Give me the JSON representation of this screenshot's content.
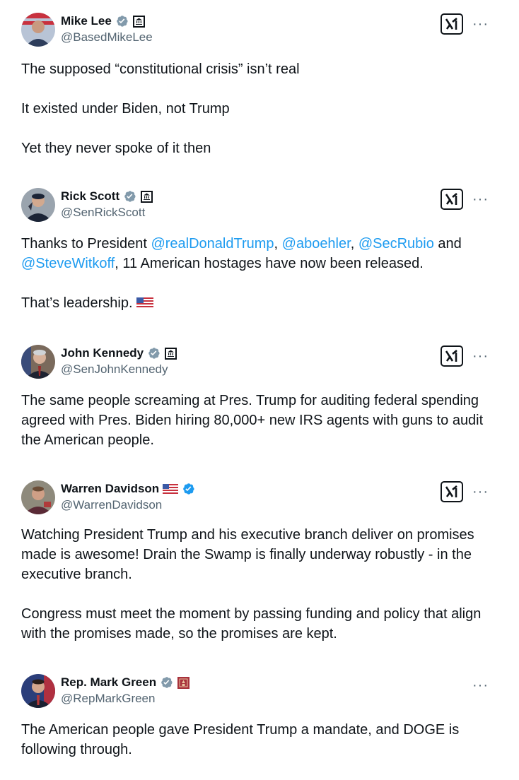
{
  "tweets": [
    {
      "name": "Mike Lee",
      "handle": "@BasedMikeLee",
      "badge": "government-icon",
      "paragraphs": [
        "The supposed “constitutional crisis” isn’t real",
        "It existed under Biden, not Trump",
        "Yet they never spoke of it then"
      ],
      "has_grok": true
    },
    {
      "name": "Rick Scott",
      "handle": "@SenRickScott",
      "badge": "government-icon",
      "p1_prefix": "Thanks to President ",
      "mention_1": "@realDonaldTrump",
      "sep_1": ", ",
      "mention_2": "@aboehler",
      "sep_2": ", ",
      "mention_3": "@SecRubio",
      "sep_3": " and ",
      "mention_4": "@SteveWitkoff",
      "p1_suffix": ", 11 American hostages have now been released.",
      "p2": "That’s leadership.",
      "flag": "us-flag-icon",
      "has_grok": true
    },
    {
      "name": "John Kennedy",
      "handle": "@SenJohnKennedy",
      "badge": "government-icon",
      "paragraphs": [
        "The same people screaming at Pres. Trump for auditing federal spending agreed with Pres. Biden hiring 80,000+ new IRS agents with guns to audit the American people."
      ],
      "has_grok": true
    },
    {
      "name": "Warren Davidson",
      "handle": "@WarrenDavidson",
      "badge": "us-flag-icon",
      "paragraphs": [
        "Watching President Trump and his executive branch deliver on promises made is awesome! Drain the Swamp is finally underway robustly - in the executive branch.",
        "Congress must meet the moment by passing funding and policy that align with the promises made, so the promises are kept."
      ],
      "has_grok": true
    },
    {
      "name": "Rep. Mark Green",
      "handle": "@RepMarkGreen",
      "badge": "government-icon",
      "paragraphs": [
        "The American people gave President Trump a mandate, and DOGE is following through."
      ],
      "has_grok": false
    }
  ],
  "more_label": "···",
  "colors": {
    "text": "#0f1419",
    "secondary": "#536471",
    "link": "#1d9bf0",
    "verified_gray": "#829aab",
    "verified_blue": "#1d9bf0"
  }
}
